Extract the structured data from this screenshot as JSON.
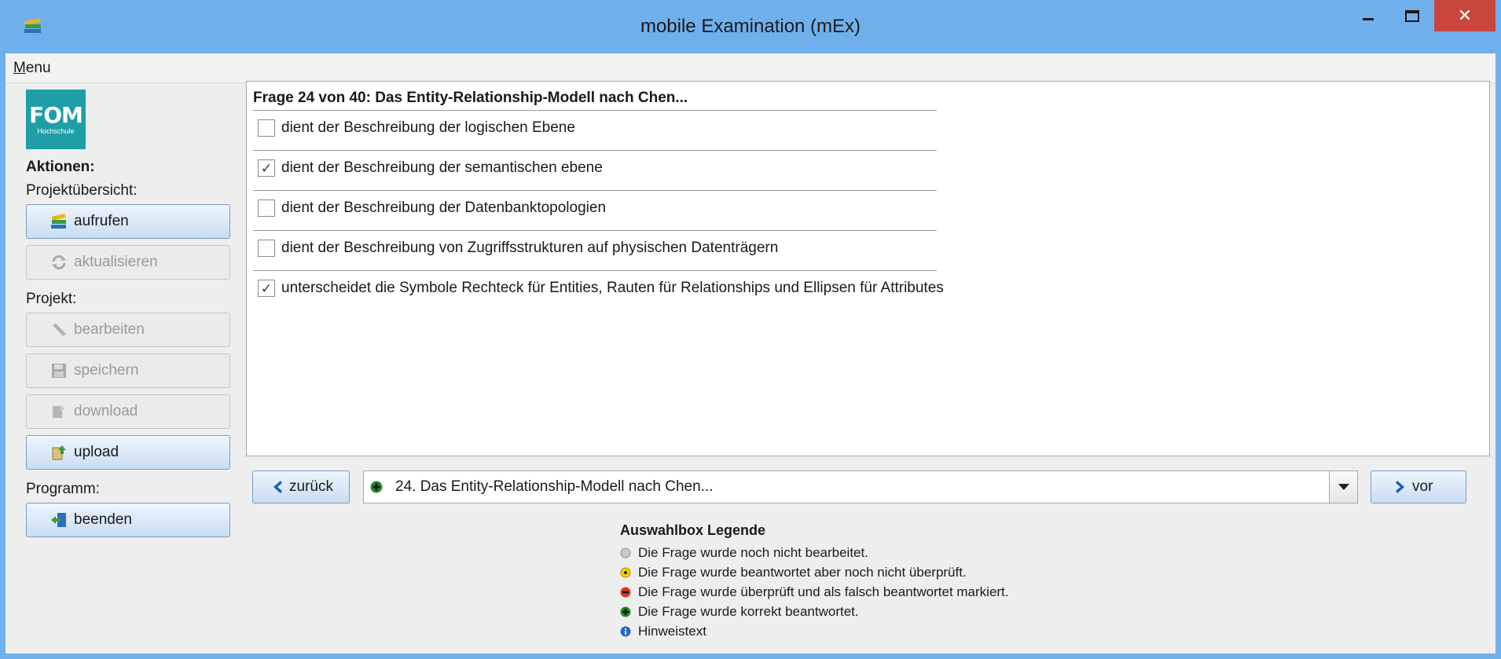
{
  "window": {
    "title": "mobile Examination (mEx)",
    "close_glyph": "✕"
  },
  "menubar": {
    "menu_label": "Menu"
  },
  "logo": {
    "big": "FOM",
    "small": "Hochschule"
  },
  "sidebar": {
    "heading": "Aktionen:",
    "group_projektuebersicht": "Projektübersicht:",
    "btn_aufrufen": "aufrufen",
    "btn_aktualisieren": "aktualisieren",
    "group_projekt": "Projekt:",
    "btn_bearbeiten": "bearbeiten",
    "btn_speichern": "speichern",
    "btn_download": "download",
    "btn_upload": "upload",
    "group_programm": "Programm:",
    "btn_beenden": "beenden"
  },
  "question": {
    "title": "Frage 24 von 40: Das Entity-Relationship-Modell nach Chen...",
    "options": [
      {
        "label": "dient der Beschreibung der logischen Ebene",
        "checked": false
      },
      {
        "label": "dient der Beschreibung der semantischen ebene",
        "checked": true
      },
      {
        "label": "dient der Beschreibung der Datenbanktopologien",
        "checked": false
      },
      {
        "label": "dient der Beschreibung von Zugriffsstrukturen auf physischen Datenträgern",
        "checked": false
      },
      {
        "label": "unterscheidet die Symbole Rechteck für Entities, Rauten für Relationships und Ellipsen für Attributes",
        "checked": true
      }
    ],
    "check_glyph": "✓"
  },
  "navigation": {
    "prev_label": "zurück",
    "next_label": "vor",
    "selected_question": "24. Das Entity-Relationship-Modell nach Chen...",
    "selected_status_icon": "green-plus-icon"
  },
  "legend": {
    "title": "Auswahlbox Legende",
    "items": [
      {
        "icon": "gray-circle-icon",
        "text": "Die Frage wurde noch nicht bearbeitet."
      },
      {
        "icon": "yellow-dot-icon",
        "text": "Die Frage wurde beantwortet aber noch nicht überprüft."
      },
      {
        "icon": "red-minus-icon",
        "text": "Die Frage wurde überprüft und als falsch beantwortet markiert."
      },
      {
        "icon": "green-plus-icon",
        "text": "Die Frage wurde korrekt beantwortet."
      },
      {
        "icon": "info-icon",
        "text": "Hinweistext"
      }
    ]
  },
  "colors": {
    "titlebar": "#6fb0ec",
    "close": "#c8463c",
    "logo": "#1f9ea8",
    "button_border": "#7a9cc4"
  }
}
